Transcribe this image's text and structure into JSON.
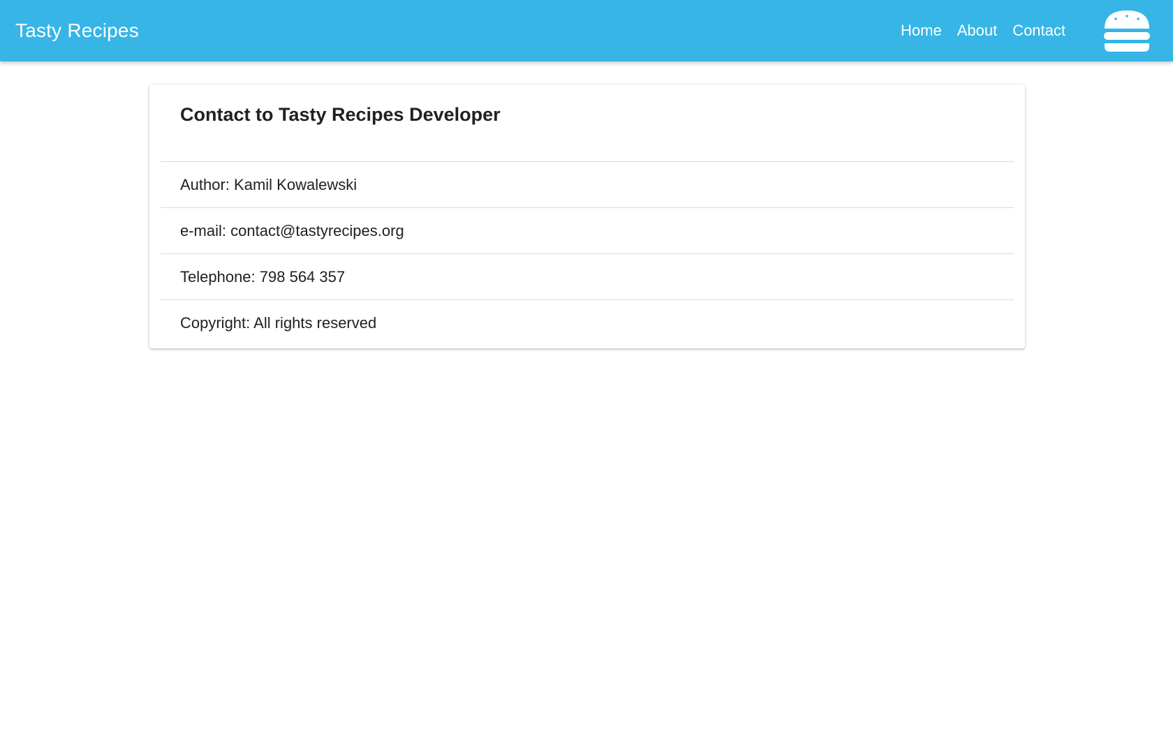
{
  "navbar": {
    "brand": "Tasty Recipes",
    "links": [
      "Home",
      "About",
      "Contact"
    ],
    "logo_icon": "burger-icon",
    "background": "#36b5e6"
  },
  "card": {
    "title": "Contact to Tasty Recipes Developer",
    "items": [
      "Author: Kamil Kowalewski",
      "e-mail: contact@tastyrecipes.org",
      "Telephone: 798 564 357",
      "Copyright: All rights reserved"
    ]
  }
}
